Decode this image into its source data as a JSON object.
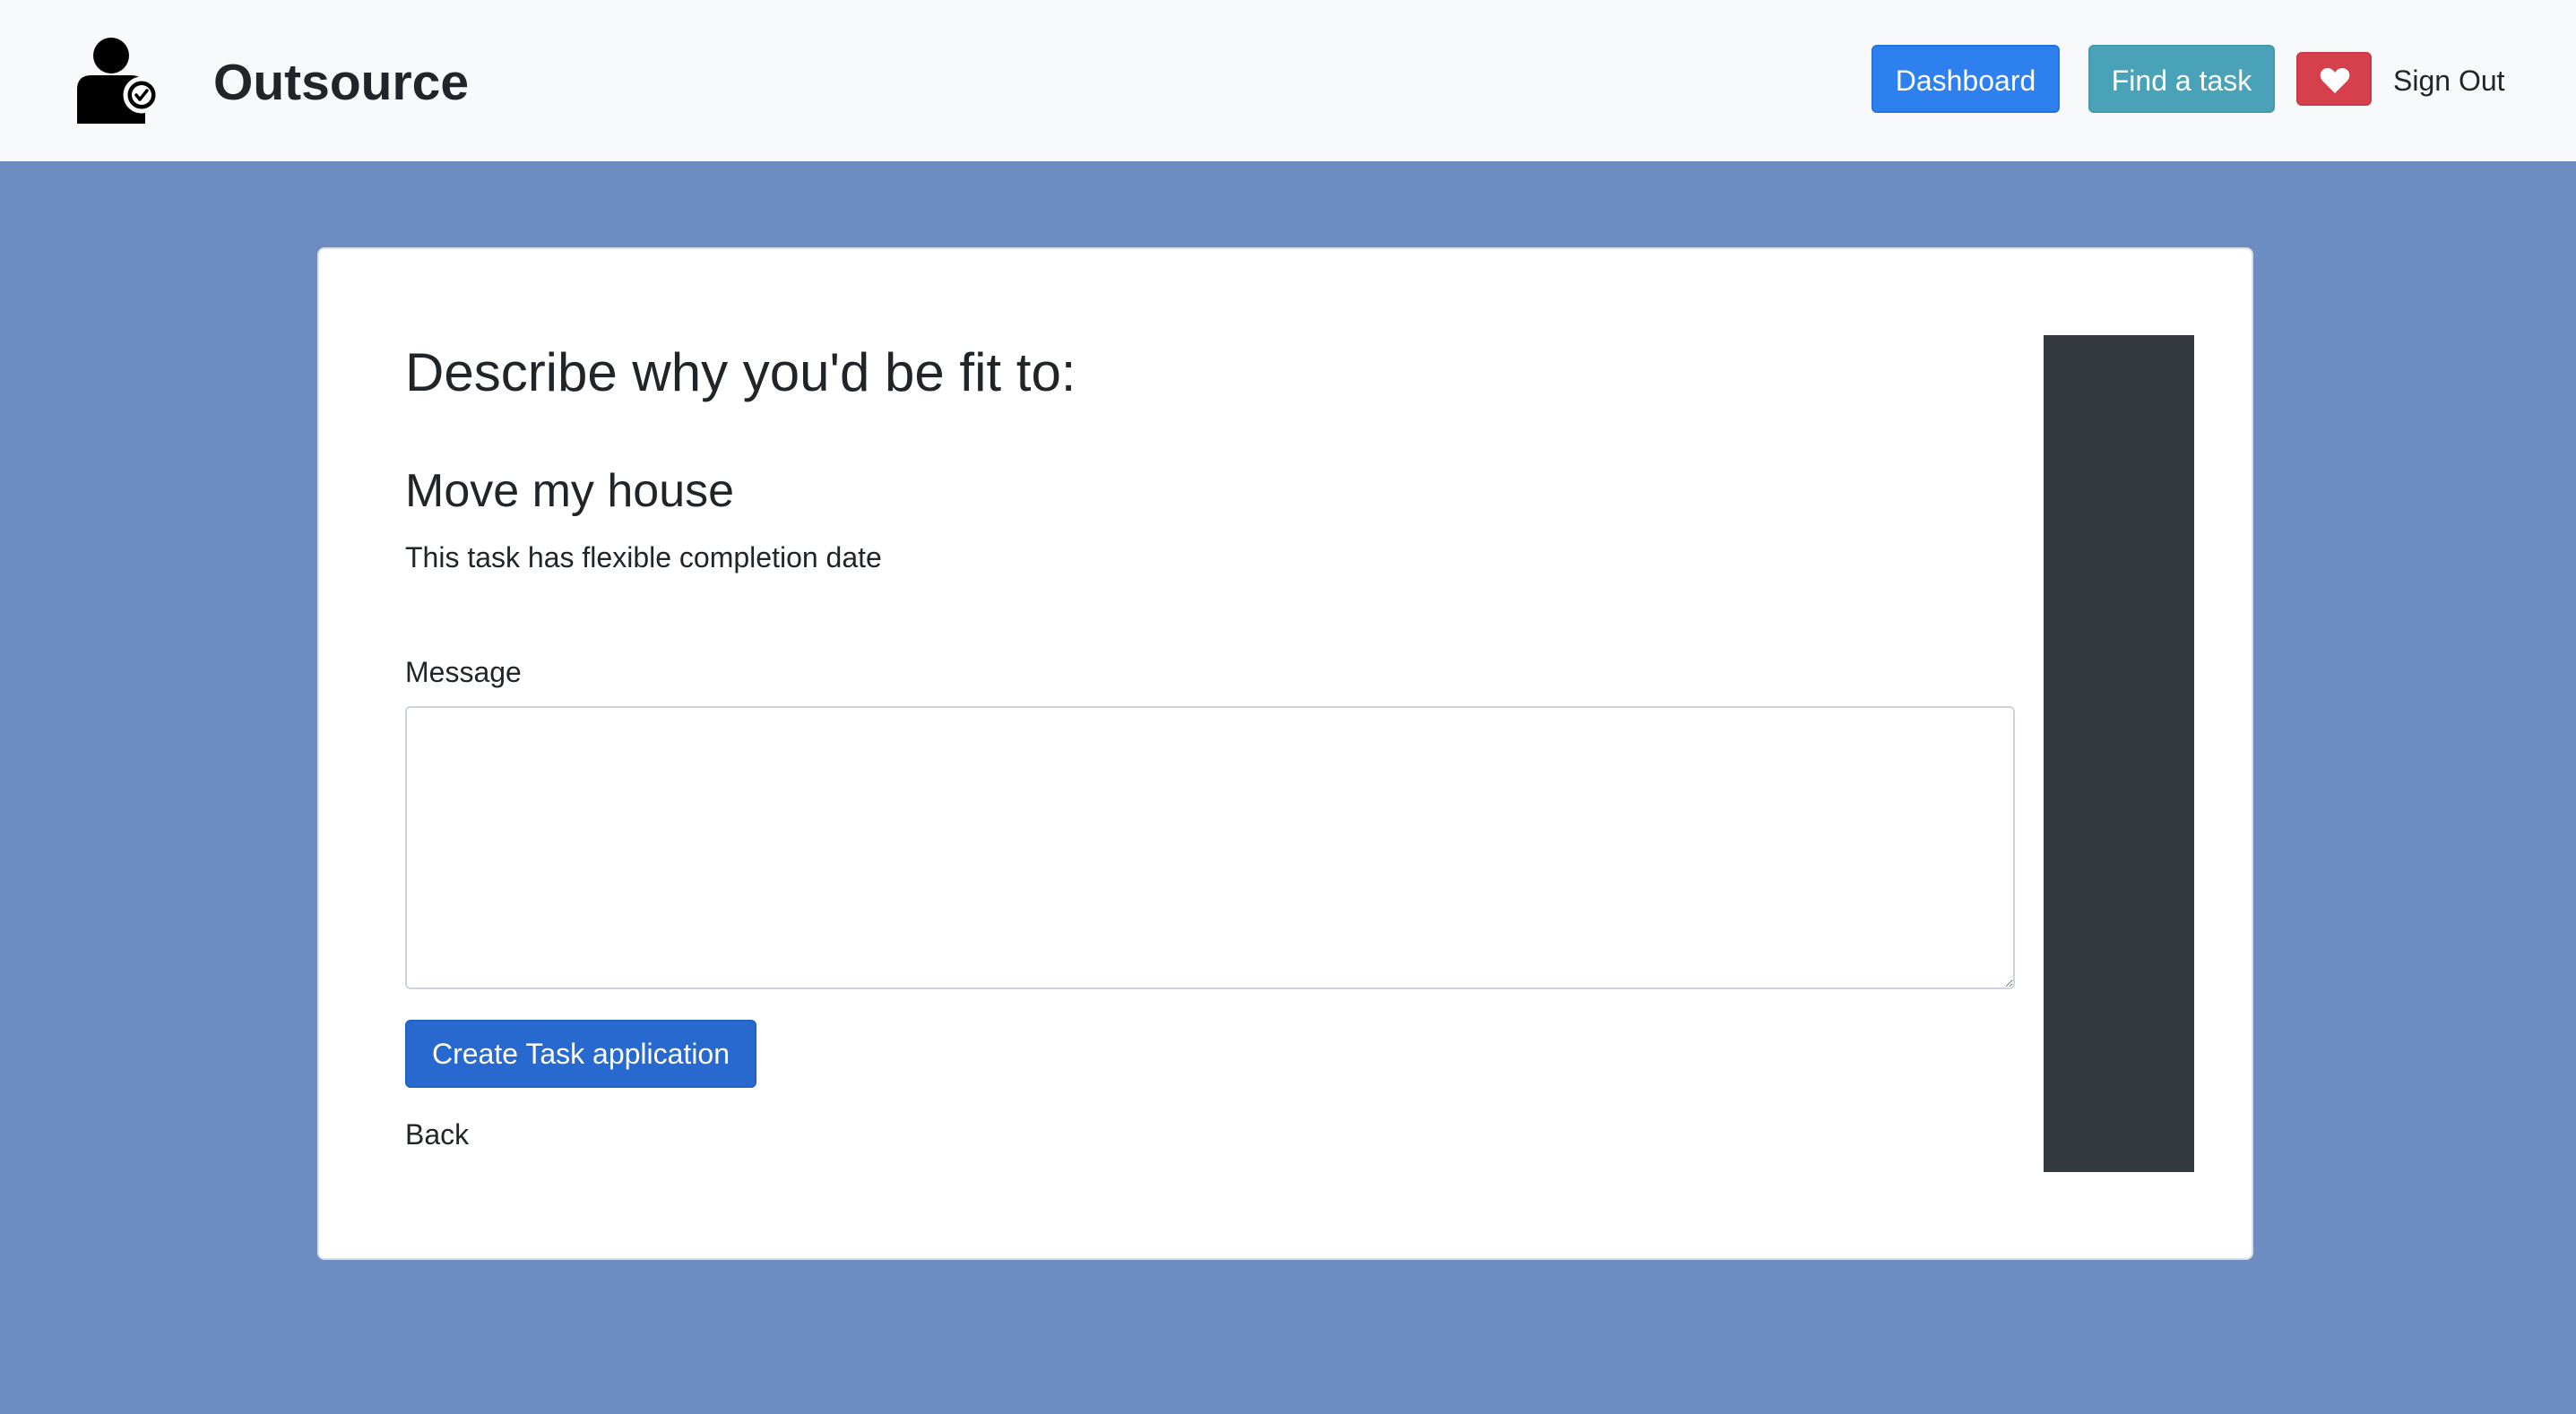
{
  "app": {
    "name": "Outsource",
    "logo_icon": "person-check-icon"
  },
  "navbar": {
    "dashboard_label": "Dashboard",
    "find_task_label": "Find a task",
    "favorites_icon": "heart-icon",
    "sign_out_label": "Sign Out"
  },
  "form": {
    "heading": "Describe why you'd be fit to:",
    "task_title": "Move my house",
    "task_note": "This task has flexible completion date",
    "message_label": "Message",
    "message_value": "",
    "submit_label": "Create Task application",
    "back_label": "Back"
  },
  "colors": {
    "page_background": "#6d8cc2",
    "navbar_background": "#f8f9fa",
    "dashboard_button": "#2f80ef",
    "find_task_button": "#4aa2b8",
    "favorites_button": "#d6404d",
    "submit_button": "#2769cf",
    "side_panel": "#343a40"
  }
}
